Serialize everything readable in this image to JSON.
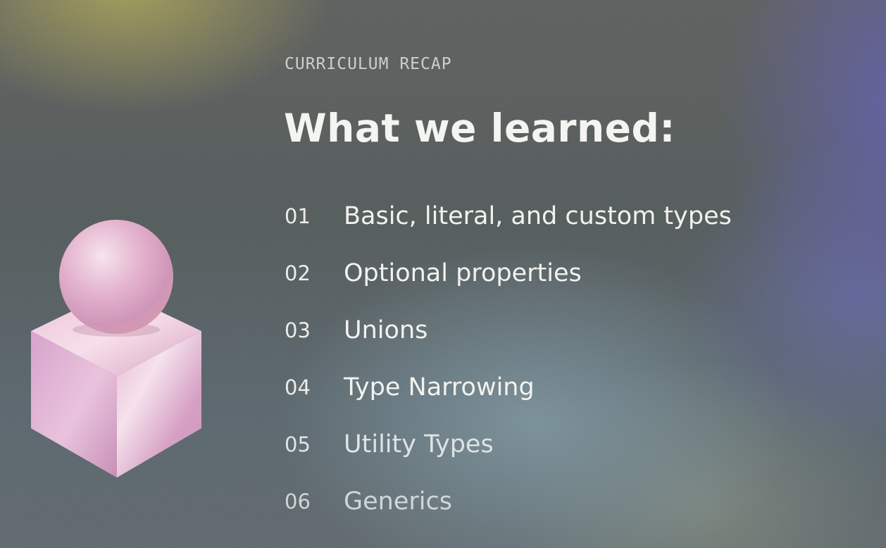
{
  "eyebrow": "CURRICULUM RECAP",
  "title": "What we learned:",
  "topics": [
    {
      "number": "01",
      "label": "Basic, literal, and custom types"
    },
    {
      "number": "02",
      "label": "Optional properties"
    },
    {
      "number": "03",
      "label": "Unions"
    },
    {
      "number": "04",
      "label": "Type Narrowing"
    },
    {
      "number": "05",
      "label": "Utility Types"
    },
    {
      "number": "06",
      "label": "Generics"
    }
  ],
  "colors": {
    "text": "#f2f2ee",
    "eyebrow": "#cfcfc8",
    "shape_pink": "#d9a6c8",
    "shape_highlight": "#f3dcea"
  },
  "illustration": "sphere-on-cube"
}
